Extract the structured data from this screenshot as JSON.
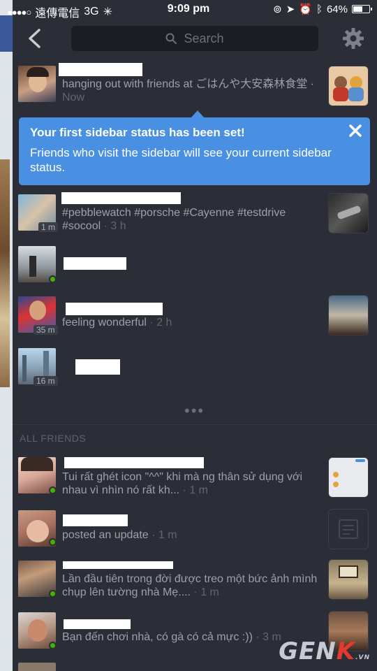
{
  "status_bar": {
    "carrier": "遠傳電信",
    "network": "3G",
    "time": "9:09 pm",
    "battery": "64%",
    "battery_level": 0.64
  },
  "nav": {
    "search_placeholder": "Search"
  },
  "rows": [
    {
      "line1": "hanging out with friends at ごはんや大安森林食堂 ·",
      "line2": "Now"
    },
    {
      "line1": "#pebblewatch #porsche #Cayenne #testdrive",
      "line2": "#socool",
      "time": " · 3 h",
      "ago": "1 m"
    },
    {
      "ago": ""
    },
    {
      "line1": "feeling wonderful",
      "time": " · 2 h",
      "ago": "35 m"
    },
    {
      "ago": "16 m"
    }
  ],
  "tooltip": {
    "title": "Your first sidebar status has been set!",
    "body": "Friends who visit the sidebar will see your current sidebar status."
  },
  "section_label": "ALL FRIENDS",
  "friends": [
    {
      "line1": "Tui rất ghét icon \"^^\" khi mà ng thân sử dụng với",
      "line2": "nhau vì nhìn nó rất kh...",
      "time": " · 1 m"
    },
    {
      "line1": "posted an update",
      "time": " · 1 m"
    },
    {
      "line1": "Lần đầu tiên trong đời được treo một bức ảnh mình",
      "line2": "chụp lên tường nhà Mẹ....",
      "time": " · 1 m"
    },
    {
      "line1": "Bạn đến chơi nhà, có gà có cả mực :))",
      "time": " · 3 m"
    }
  ],
  "watermark": {
    "main": "GEN",
    "k": "K",
    "suffix": ".VN"
  }
}
